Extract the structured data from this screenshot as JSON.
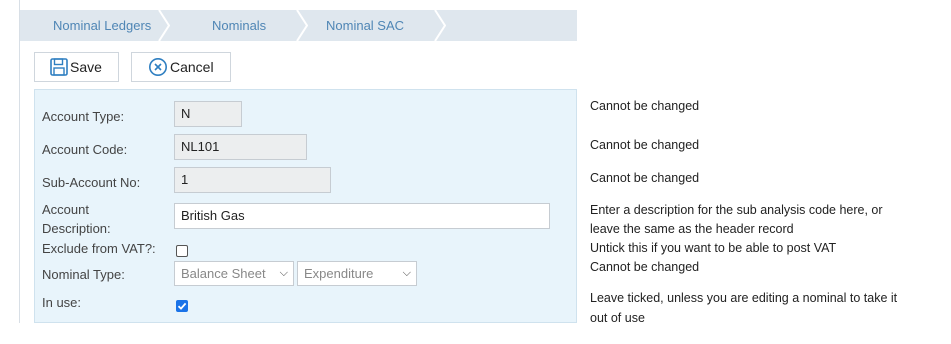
{
  "breadcrumb": {
    "items": [
      {
        "label": "Nominal Ledgers"
      },
      {
        "label": "Nominals"
      },
      {
        "label": "Nominal SAC"
      }
    ]
  },
  "toolbar": {
    "save_label": "Save",
    "cancel_label": "Cancel"
  },
  "form": {
    "account_type": {
      "label": "Account Type:",
      "value": "N"
    },
    "account_code": {
      "label": "Account Code:",
      "value": "NL101"
    },
    "sub_account_no": {
      "label": "Sub-Account No:",
      "value": "1"
    },
    "account_description": {
      "label_line1": "Account",
      "label_line2": "Description:",
      "value": "British Gas"
    },
    "exclude_from_vat": {
      "label": "Exclude from VAT?:",
      "checked": false
    },
    "nominal_type": {
      "label": "Nominal Type:",
      "select1": "Balance Sheet",
      "select2": "Expenditure"
    },
    "in_use": {
      "label": "In use:",
      "checked": true
    }
  },
  "notes": {
    "account_type": "Cannot be changed",
    "account_code": "Cannot be changed",
    "sub_account_no": "Cannot be changed",
    "description_line1": "Enter a description for the sub analysis code here, or",
    "description_line2": "leave the same as the header record",
    "vat": "Untick this if you want to be able to post VAT",
    "nominal_type": "Cannot be changed",
    "in_use_line1": "Leave ticked, unless you are editing a nominal to take it",
    "in_use_line2": "out of use"
  },
  "colors": {
    "breadcrumb_bg": "#dfe7ee",
    "breadcrumb_text": "#4f86b5",
    "form_bg": "#e8f4fb",
    "icon_blue": "#2f7fc1",
    "checkbox_checked": "#1a73e8"
  }
}
